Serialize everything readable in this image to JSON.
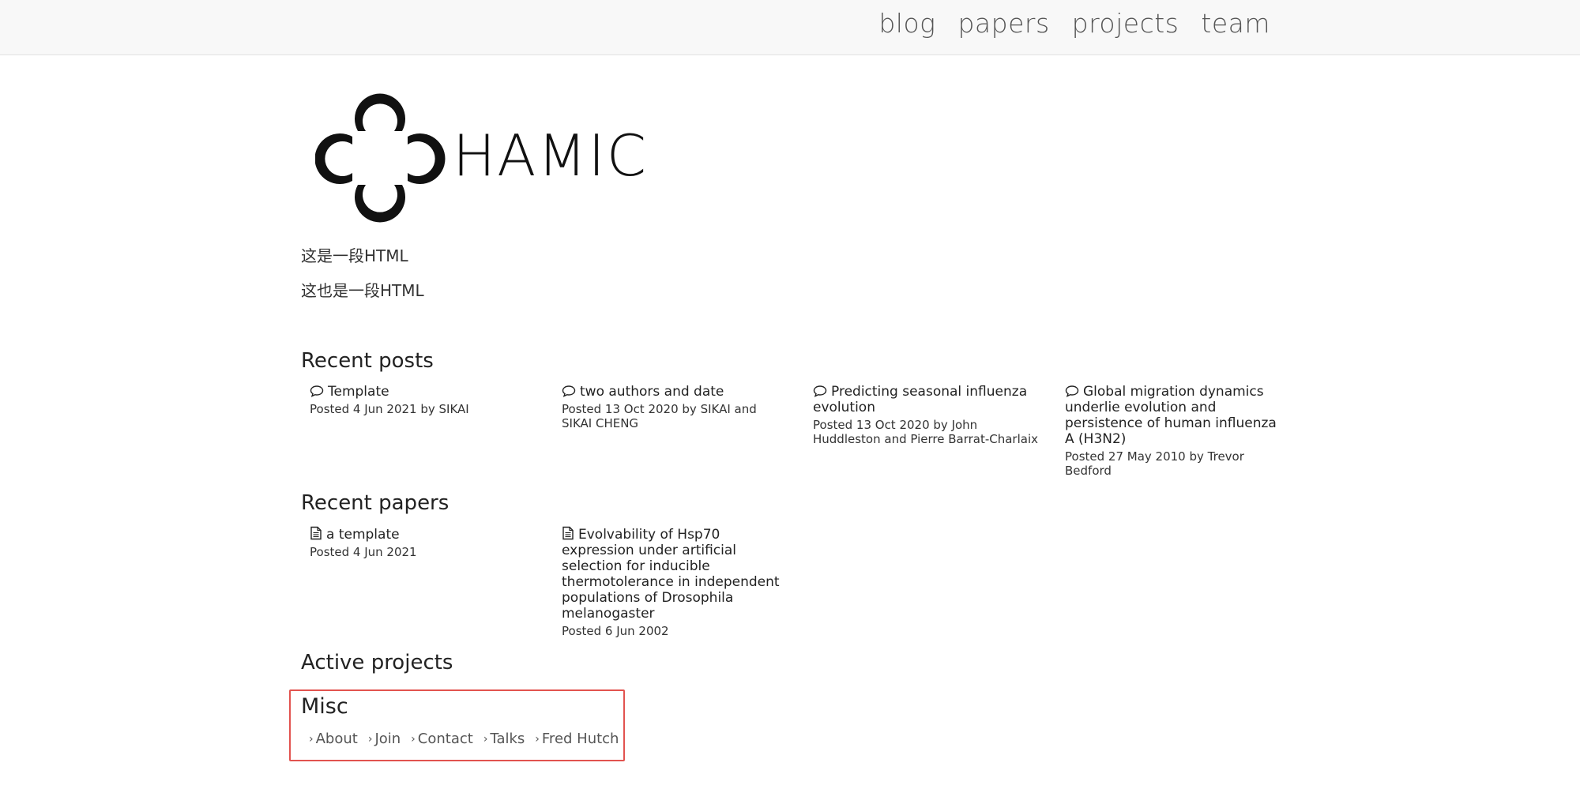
{
  "nav": {
    "items": [
      {
        "label": "blog"
      },
      {
        "label": "papers"
      },
      {
        "label": "projects"
      },
      {
        "label": "team"
      }
    ]
  },
  "logo": {
    "text": "HAMIC"
  },
  "intro": {
    "line1": "这是一段HTML",
    "line2": "这也是一段HTML"
  },
  "recent_posts": {
    "title": "Recent posts",
    "items": [
      {
        "title": "Template",
        "meta": "Posted 4 Jun 2021 by SIKAI"
      },
      {
        "title": "two authors and date",
        "meta": "Posted 13 Oct 2020 by SIKAI and SIKAI CHENG"
      },
      {
        "title": "Predicting seasonal influenza evolution",
        "meta": "Posted 13 Oct 2020 by John Huddleston and Pierre Barrat-Charlaix"
      },
      {
        "title": "Global migration dynamics underlie evolution and persistence of human influenza A (H3N2)",
        "meta": "Posted 27 May 2010 by Trevor Bedford"
      }
    ]
  },
  "recent_papers": {
    "title": "Recent papers",
    "items": [
      {
        "title": "a template",
        "meta": "Posted 4 Jun 2021"
      },
      {
        "title": "Evolvability of Hsp70 expression under artificial selection for inducible thermotolerance in independent populations of Drosophila melanogaster",
        "meta": "Posted 6 Jun 2002"
      }
    ]
  },
  "active_projects": {
    "title": "Active projects"
  },
  "misc": {
    "title": "Misc",
    "links": [
      {
        "label": "About"
      },
      {
        "label": "Join"
      },
      {
        "label": "Contact"
      },
      {
        "label": "Talks"
      },
      {
        "label": "Fred Hutch"
      }
    ]
  },
  "colors": {
    "highlight_border": "#e2534f",
    "topbar_bg": "#f8f8f8",
    "link_gray": "#555555"
  },
  "icons": {
    "post": "speech-bubble-icon",
    "paper": "document-icon",
    "link": "chevron-right-icon"
  }
}
